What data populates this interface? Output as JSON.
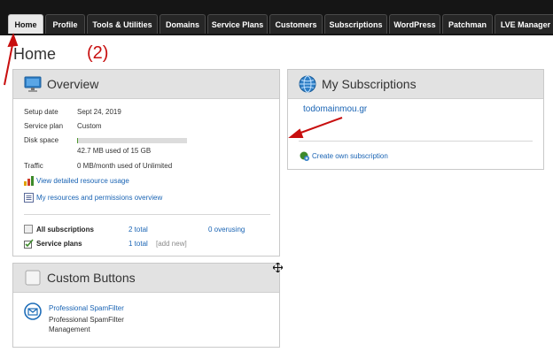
{
  "nav": {
    "tabs": [
      {
        "label": "Home",
        "active": true
      },
      {
        "label": "Profile"
      },
      {
        "label": "Tools & Utilities"
      },
      {
        "label": "Domains"
      },
      {
        "label": "Service Plans"
      },
      {
        "label": "Customers"
      },
      {
        "label": "Subscriptions"
      },
      {
        "label": "WordPress"
      },
      {
        "label": "Patchman"
      },
      {
        "label": "LVE Manager"
      }
    ]
  },
  "page": {
    "title": "Home"
  },
  "annotation": {
    "step_number": "(2)",
    "color": "#c80f0f"
  },
  "overview": {
    "title": "Overview",
    "setup_date_label": "Setup date",
    "setup_date_value": "Sept 24, 2019",
    "service_plan_label": "Service plan",
    "service_plan_value": "Custom",
    "disk_space_label": "Disk space",
    "disk_space_value": "42.7 MB used of 15 GB",
    "disk_used_fraction": 0.003,
    "traffic_label": "Traffic",
    "traffic_value": "0 MB/month used of Unlimited",
    "resource_usage_link": "View detailed resource usage",
    "permissions_link": "My resources and permissions overview",
    "all_subscriptions_label": "All subscriptions",
    "all_subscriptions_total": "2 total",
    "all_subscriptions_overusing": "0 overusing",
    "service_plans_label": "Service plans",
    "service_plans_total": "1 total",
    "service_plans_add": "[add new]"
  },
  "custom_buttons": {
    "title": "Custom Buttons",
    "spamfilter_link": "Professional SpamFilter",
    "spamfilter_desc_line1": "Professional SpamFilter",
    "spamfilter_desc_line2": "Management"
  },
  "subscriptions": {
    "title": "My Subscriptions",
    "domain": "todomainmou.gr",
    "create_link": "Create own subscription"
  },
  "colors": {
    "nav_bg": "#151515",
    "link": "#1a64b4",
    "panel_header": "#e2e2e2"
  }
}
